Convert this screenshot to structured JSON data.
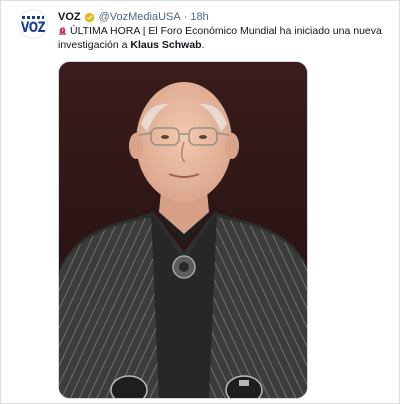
{
  "tweet": {
    "display_name": "VOZ",
    "handle": "@VozMediaUSA",
    "separator": "·",
    "time": "18h",
    "avatar_logo_text": "VOZ",
    "text_prefix": "ÚLTIMA HORA | El Foro Económico Mundial ha iniciado una nueva investigación a ",
    "text_bold": "Klaus Schwab",
    "text_suffix": ".",
    "siren_icon": "police-light-icon",
    "verified_icon": "gold-verified-badge-icon",
    "media_description": "photo"
  },
  "colors": {
    "verified_gold": "#e2b719",
    "siren_red": "#e0245e",
    "handle_gray": "#536471",
    "logo_blue": "#1a3d8f"
  }
}
